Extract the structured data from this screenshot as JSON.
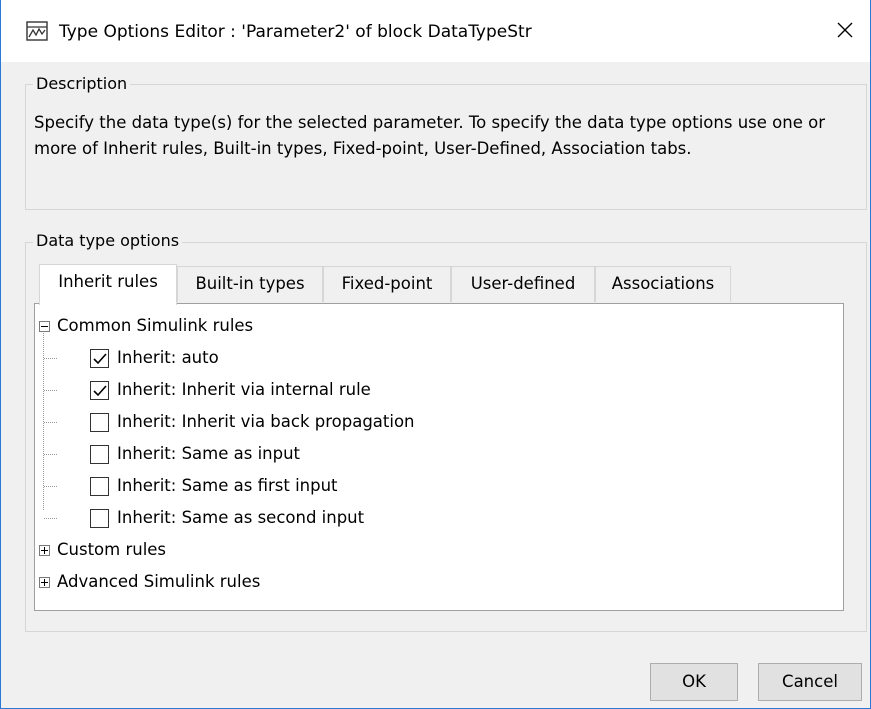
{
  "window": {
    "title": "Type Options Editor : 'Parameter2' of block DataTypeStr",
    "icon": "simulink-block-icon",
    "close_glyph": "✕"
  },
  "description": {
    "legend": "Description",
    "text": "Specify the data type(s) for the selected parameter. To specify the data type options use one or more of Inherit rules, Built-in types, Fixed-point, User-Defined, Association tabs."
  },
  "options": {
    "legend": "Data type options",
    "tabs": [
      {
        "label": "Inherit rules",
        "active": true
      },
      {
        "label": "Built-in types",
        "active": false
      },
      {
        "label": "Fixed-point",
        "active": false
      },
      {
        "label": "User-defined",
        "active": false
      },
      {
        "label": "Associations",
        "active": false
      }
    ],
    "tree": {
      "groups": [
        {
          "label": "Common Simulink rules",
          "expanded": true,
          "items": [
            {
              "label": "Inherit: auto",
              "checked": true
            },
            {
              "label": "Inherit: Inherit via internal rule",
              "checked": true
            },
            {
              "label": "Inherit: Inherit via back propagation",
              "checked": false
            },
            {
              "label": "Inherit: Same as input",
              "checked": false
            },
            {
              "label": "Inherit: Same as first input",
              "checked": false
            },
            {
              "label": "Inherit: Same as second input",
              "checked": false
            }
          ]
        },
        {
          "label": "Custom rules",
          "expanded": false
        },
        {
          "label": "Advanced Simulink rules",
          "expanded": false
        }
      ]
    }
  },
  "buttons": {
    "ok": "OK",
    "cancel": "Cancel"
  },
  "colors": {
    "window_border": "#2b79d6",
    "dialog_bg": "#f0f0f0",
    "pane_bg": "#ffffff"
  }
}
